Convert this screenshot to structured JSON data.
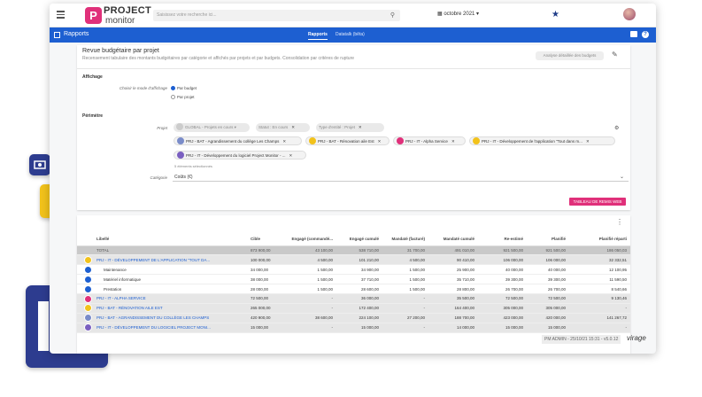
{
  "app": {
    "logo_letter": "P",
    "logo_line1": "PROJECT",
    "logo_line2": "monitor",
    "search_placeholder": "Saisissez votre recherche ici...",
    "period": "octobre 2021"
  },
  "nav": {
    "section": "Rapports",
    "tabs": [
      "Rapports",
      "Datatalk (bêta)"
    ]
  },
  "report": {
    "title": "Revue budgétaire par projet",
    "subtitle": "Recensement tabulaire des montants budgétaires par catégorie et affichés par projets et par budgets. Consolidation par critères de rupture",
    "detail_button": "Analyse détaillée des budgets",
    "display_section": "Affichage",
    "display_label": "Choisir le mode d'affichage",
    "display_options": [
      "Par budget",
      "Par projet"
    ],
    "scope_section": "Périmètre",
    "project_label": "Projet",
    "filters": [
      "GLOBAL - Projets en cours",
      "Statut : En cours",
      "Type d'entité : Projet"
    ],
    "selected_projects": [
      "PRJ - BAT - Agrandissement du collège Les Champs",
      "PRJ - BAT - Rénovation aile Est",
      "PRJ - IT - Alpha Service",
      "PRJ - IT - Développement de l'application \"Tout dans m...",
      "PRJ - IT - Développement du logiciel Project Monitor - ..."
    ],
    "selected_count": "5 éléments sélectionnés",
    "category_label": "Catégorie",
    "category_value": "Coûts (€)",
    "pivot_button": "TABLEAU DE REMIS WEB"
  },
  "table": {
    "headers": [
      "Libellé",
      "Cible",
      "Engagé (commandé...",
      "Engagé cumulé",
      "Mandaté (facturé)",
      "Mandaté cumulé",
      "Re-estimé",
      "Planifié",
      "Planifié réparti"
    ],
    "rows": [
      {
        "type": "total",
        "label": "TOTAL",
        "values": [
          "873 900,00",
          "43 100,00",
          "538 710,00",
          "31 700,00",
          "491 010,00",
          "921 500,00",
          "921 500,00",
          "186 050,03"
        ]
      },
      {
        "type": "proj",
        "label": "PRJ - IT - DÉVELOPPEMENT DE L'APPLICATION \"TOUT DA...",
        "values": [
          "100 000,00",
          "4 500,00",
          "101 210,00",
          "4 500,00",
          "90 410,00",
          "106 000,00",
          "106 000,00",
          "32 332,51"
        ]
      },
      {
        "type": "sub",
        "label": "Maintenance",
        "values": [
          "34 000,00",
          "1 500,00",
          "34 900,00",
          "1 500,00",
          "25 900,00",
          "40 000,00",
          "40 000,00",
          "12 100,95"
        ]
      },
      {
        "type": "sub",
        "label": "Matériel informatique",
        "values": [
          "38 000,00",
          "1 500,00",
          "37 710,00",
          "1 500,00",
          "35 710,00",
          "39 300,00",
          "39 300,00",
          "11 590,50"
        ]
      },
      {
        "type": "sub",
        "label": "Prestation",
        "values": [
          "28 000,00",
          "1 500,00",
          "28 600,00",
          "1 500,00",
          "28 800,00",
          "26 700,00",
          "26 700,00",
          "8 540,66"
        ]
      },
      {
        "type": "proj",
        "label": "PRJ - IT - ALPHA SERVICE",
        "values": [
          "72 500,00",
          "-",
          "36 000,00",
          "-",
          "35 500,00",
          "72 500,00",
          "72 500,00",
          "9 130,46"
        ]
      },
      {
        "type": "proj",
        "label": "PRJ - BAT - RÉNOVATION AILE EST",
        "values": [
          "265 000,00",
          "-",
          "172 400,00",
          "-",
          "164 400,00",
          "305 000,00",
          "305 000,00",
          "-"
        ]
      },
      {
        "type": "proj",
        "label": "PRJ - BAT - AGRANDISSEMENT DU COLLÈGE LES CHAMPS",
        "values": [
          "420 900,00",
          "38 600,00",
          "224 100,00",
          "27 200,00",
          "188 700,00",
          "423 000,00",
          "420 000,00",
          "141 267,72"
        ]
      },
      {
        "type": "proj",
        "label": "PRJ - IT - DÉVELOPPEMENT DU LOGICIEL PROJECT MONI...",
        "values": [
          "15 000,00",
          "-",
          "15 000,00",
          "-",
          "14 000,00",
          "15 000,00",
          "15 000,00",
          "-"
        ]
      }
    ]
  },
  "footer": {
    "watermark": "PM ADMIN - 25/10/21 15:31 - v5.0.12",
    "brand": "virage"
  }
}
